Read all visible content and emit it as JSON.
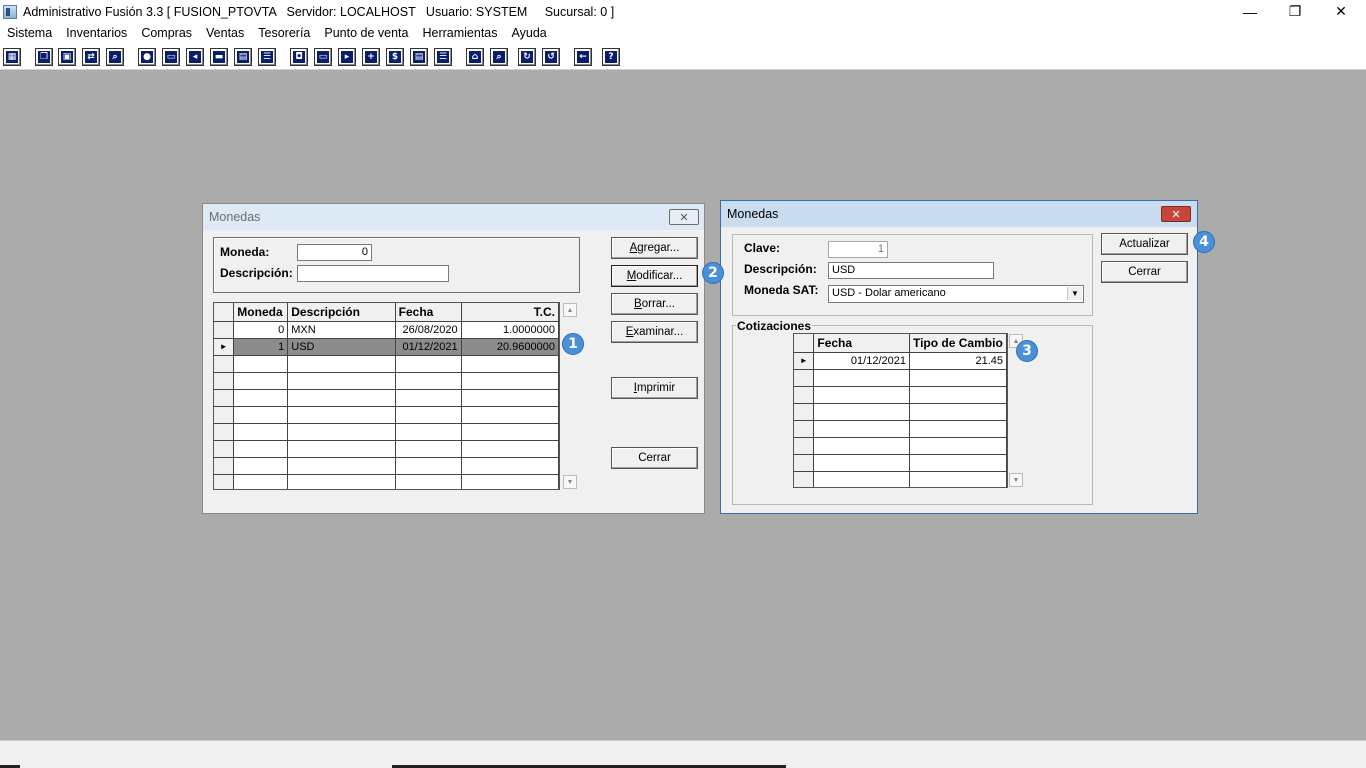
{
  "window": {
    "title": "Administrativo Fusión 3.3 [ FUSION_PTOVTA   Servidor: LOCALHOST   Usuario: SYSTEM     Sucursal: 0 ]",
    "minimize_glyph": "—",
    "restore_glyph": "❐",
    "close_glyph": "✕"
  },
  "menu": [
    "Sistema",
    "Inventarios",
    "Compras",
    "Ventas",
    "Tesorería",
    "Punto de venta",
    "Herramientas",
    "Ayuda"
  ],
  "toolbar_icons": [
    "calculator-icon",
    "copy-icon",
    "clipboard-icon",
    "swap-icon",
    "search-doc-icon",
    "user-icon",
    "folder-icon",
    "import-icon",
    "print-icon",
    "document-icon",
    "list-icon",
    "binoculars-icon",
    "window-icon",
    "export-icon",
    "add-icon",
    "dollar-icon",
    "report-icon",
    "list2-icon",
    "home-icon",
    "zoom-icon",
    "refresh-icon",
    "undo-icon",
    "back-icon",
    "help-icon"
  ],
  "monedas_list": {
    "title": "Monedas",
    "close_glyph": "✕",
    "moneda_label": "Moneda:",
    "moneda_value": "0",
    "descripcion_label": "Descripción:",
    "descripcion_value": "",
    "columns": [
      "Moneda",
      "Descripción",
      "Fecha",
      "T.C."
    ],
    "rows": [
      {
        "moneda": "0",
        "descripcion": "MXN",
        "fecha": "26/08/2020",
        "tc": "1.0000000"
      },
      {
        "moneda": "1",
        "descripcion": "USD",
        "fecha": "01/12/2021",
        "tc": "20.9600000"
      }
    ],
    "selected_indicator": "►",
    "buttons": {
      "agregar_u": "A",
      "agregar_rest": "gregar...",
      "modificar_u": "M",
      "modificar_rest": "odificar...",
      "borrar_u": "B",
      "borrar_rest": "orrar...",
      "examinar_u": "E",
      "examinar_rest": "xaminar...",
      "imprimir_u": "I",
      "imprimir_rest": "mprimir",
      "cerrar": "Cerrar"
    }
  },
  "moneda_detail": {
    "title": "Monedas",
    "close_glyph": "✕",
    "clave_label": "Clave:",
    "clave_value": "1",
    "descripcion_label": "Descripción:",
    "descripcion_value": "USD",
    "moneda_sat_label": "Moneda SAT:",
    "moneda_sat_value": "USD - Dolar americano",
    "cotizaciones_label": "Cotizaciones",
    "columns": [
      "Fecha",
      "Tipo de Cambio"
    ],
    "rows": [
      {
        "fecha": "01/12/2021",
        "tipo_cambio": "21.45"
      }
    ],
    "selected_indicator": "►",
    "buttons": {
      "actualizar": "Actualizar",
      "cerrar": "Cerrar"
    }
  },
  "badges": [
    "1",
    "2",
    "3",
    "4"
  ],
  "colors": {
    "badge": "#4a90d9",
    "selected_row": "#8c8c8c",
    "desktop": "#ababab",
    "toolbar_icon": "#0a1e6e"
  }
}
